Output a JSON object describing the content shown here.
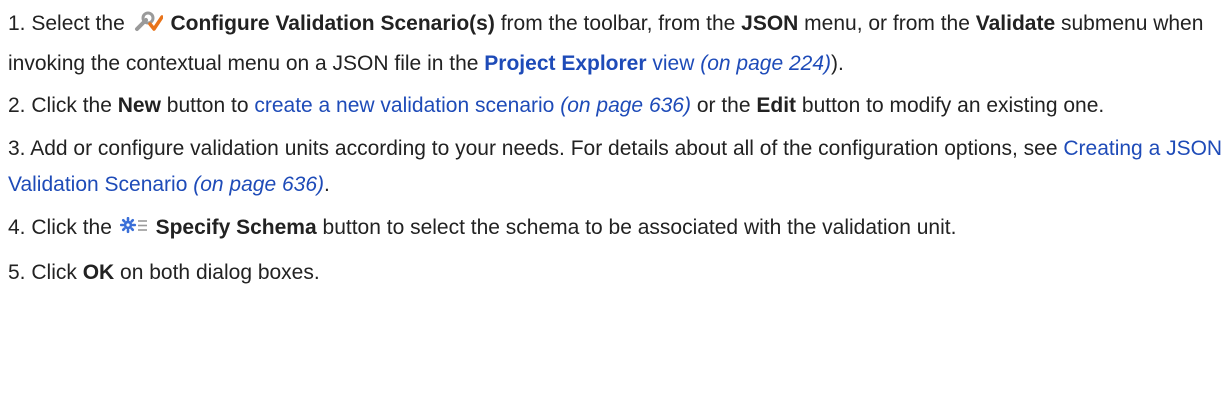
{
  "steps": [
    {
      "number": "1.",
      "t1": "Select the",
      "icon": "wrench-check-icon",
      "b1": "Configure Validation Scenario(s)",
      "t2": "from the toolbar, from the",
      "b2": "JSON",
      "t3": "menu, or from the",
      "b3": "Validate",
      "t4": "submenu when invoking the contextual menu on a JSON file in the",
      "link1": "Project Explorer",
      "link1_tail": "view",
      "ref1": "(on page 224)",
      "t5": ")."
    },
    {
      "number": "2.",
      "t1": "Click the",
      "b1": "New",
      "t2": "button to",
      "link1": "create a new validation scenario",
      "ref1": "(on page 636)",
      "t3": "or the",
      "b2": "Edit",
      "t4": "button to modify an existing one."
    },
    {
      "number": "3.",
      "t1": "Add or configure validation units according to your needs. For details about all of the configuration options, see",
      "link1": "Creating a JSON Validation Scenario",
      "ref1": "(on page 636)",
      "t2": "."
    },
    {
      "number": "4.",
      "t1": "Click the",
      "icon": "gear-list-icon",
      "b1": "Specify Schema",
      "t2": "button to select the schema to be associated with the validation unit."
    },
    {
      "number": "5.",
      "t1": "Click",
      "b1": "OK",
      "t2": "on both dialog boxes."
    }
  ],
  "colors": {
    "link": "#1e4bb8",
    "text": "#222222",
    "icon_check": "#e8731a",
    "icon_gear": "#3a6fd8"
  }
}
